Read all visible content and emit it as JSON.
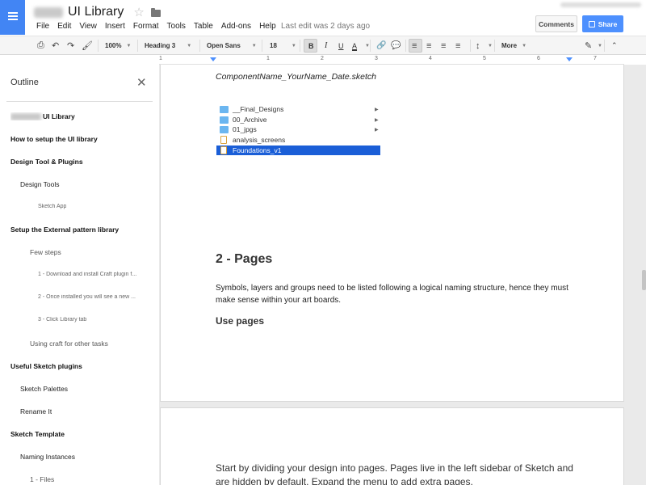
{
  "header": {
    "doc_title": "UI Library",
    "menu": [
      "File",
      "Edit",
      "View",
      "Insert",
      "Format",
      "Tools",
      "Table",
      "Add-ons",
      "Help"
    ],
    "last_edit": "Last edit was 2 days ago",
    "comments_label": "Comments",
    "share_label": "Share"
  },
  "toolbar": {
    "zoom": "100%",
    "style": "Heading 3",
    "font": "Open Sans",
    "size": "18",
    "bold": "B",
    "italic": "I",
    "underline": "U",
    "text_color": "A",
    "more": "More"
  },
  "ruler": {
    "labels": [
      "1",
      "1",
      "2",
      "3",
      "4",
      "5",
      "6",
      "7"
    ]
  },
  "outline": {
    "title": "Outline",
    "items": [
      {
        "label": "UI Library",
        "level": 1
      },
      {
        "label": "How to setup the UI library",
        "level": 1
      },
      {
        "label": "Design Tool & Plugins",
        "level": 1
      },
      {
        "label": "Design Tools",
        "level": 2
      },
      {
        "label": "Sketch App",
        "level": 4
      },
      {
        "label": "Setup  the External pattern library",
        "level": 1
      },
      {
        "label": "Few steps",
        "level": 3
      },
      {
        "label": "1 - Download and install Craft plugin f...",
        "level": 4
      },
      {
        "label": "2 - Once installed you will see a new ...",
        "level": 4
      },
      {
        "label": "3 - Click Library tab",
        "level": 4
      },
      {
        "label": "Using craft for other tasks",
        "level": 3
      },
      {
        "label": "Useful Sketch plugins",
        "level": 1
      },
      {
        "label": "Sketch Palettes",
        "level": 2
      },
      {
        "label": "Rename It",
        "level": 2
      },
      {
        "label": "Sketch Template",
        "level": 1
      },
      {
        "label": "Naming Instances",
        "level": 2
      },
      {
        "label": "1 - Files",
        "level": 3
      }
    ]
  },
  "document": {
    "filename": "ComponentName_YourName_Date.sketch",
    "finder_items": [
      {
        "label": "__Final_Designs",
        "type": "folder",
        "selected": false
      },
      {
        "label": "00_Archive",
        "type": "folder",
        "selected": false
      },
      {
        "label": "01_jpgs",
        "type": "folder",
        "selected": false
      },
      {
        "label": "analysis_screens",
        "type": "file",
        "selected": false
      },
      {
        "label": "Foundations_v1",
        "type": "file",
        "selected": true
      }
    ],
    "heading_pages": "2 - Pages",
    "paragraph_pages": "Symbols, layers and groups need to be listed following a logical naming structure, hence they must make sense within your art boards.",
    "heading_use_pages": "Use pages",
    "paragraph_next": "Start by dividing your design into pages. Pages live in the left sidebar of Sketch and are hidden by default. Expand the menu to add extra pages."
  },
  "colors": {
    "accent": "#4285f4",
    "share": "#4d90fe",
    "selection": "#1a5ed7"
  }
}
